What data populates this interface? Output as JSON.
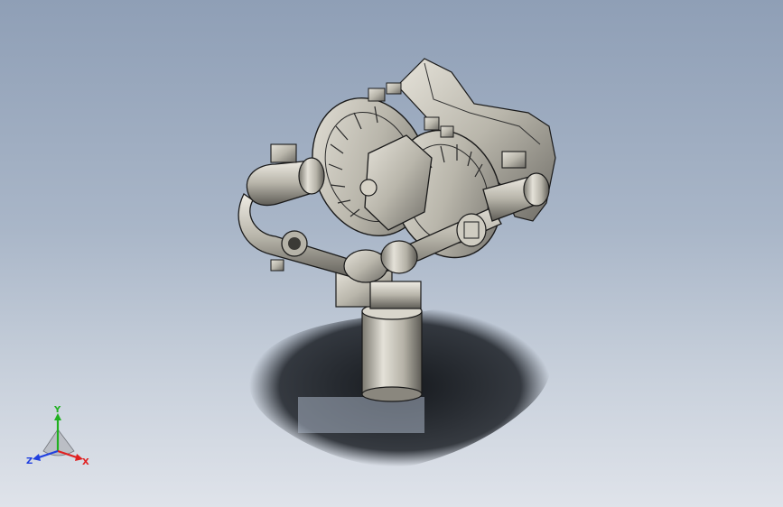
{
  "viewport": {
    "background_top": "#8f9fb6",
    "background_bottom": "#dfe3ea",
    "model_color": "#c9c6bc",
    "edge_color": "#1a1a1a",
    "shadow_color": "#111418"
  },
  "triad": {
    "x_label": "X",
    "y_label": "Y",
    "z_label": "Z",
    "x_color": "#e02020",
    "y_color": "#20b020",
    "z_color": "#2040e0"
  }
}
